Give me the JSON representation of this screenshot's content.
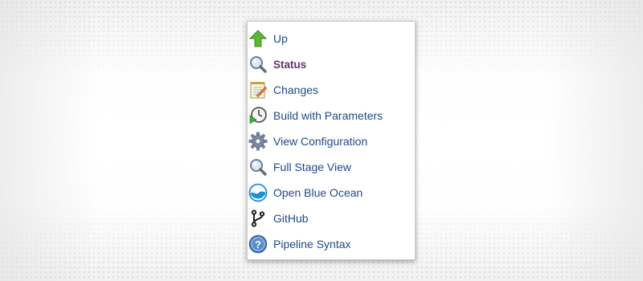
{
  "menu": {
    "items": [
      {
        "label": "Up",
        "icon": "arrow-up-icon",
        "active": false
      },
      {
        "label": "Status",
        "icon": "magnifier-icon",
        "active": true
      },
      {
        "label": "Changes",
        "icon": "notepad-icon",
        "active": false
      },
      {
        "label": "Build with Parameters",
        "icon": "clock-play-icon",
        "active": false
      },
      {
        "label": "View Configuration",
        "icon": "gear-icon",
        "active": false
      },
      {
        "label": "Full Stage View",
        "icon": "magnifier-icon",
        "active": false
      },
      {
        "label": "Open Blue Ocean",
        "icon": "blue-ocean-icon",
        "active": false
      },
      {
        "label": "GitHub",
        "icon": "git-branch-icon",
        "active": false
      },
      {
        "label": "Pipeline Syntax",
        "icon": "help-icon",
        "active": false
      }
    ]
  },
  "colors": {
    "link": "#204a87",
    "active": "#5c3566"
  }
}
